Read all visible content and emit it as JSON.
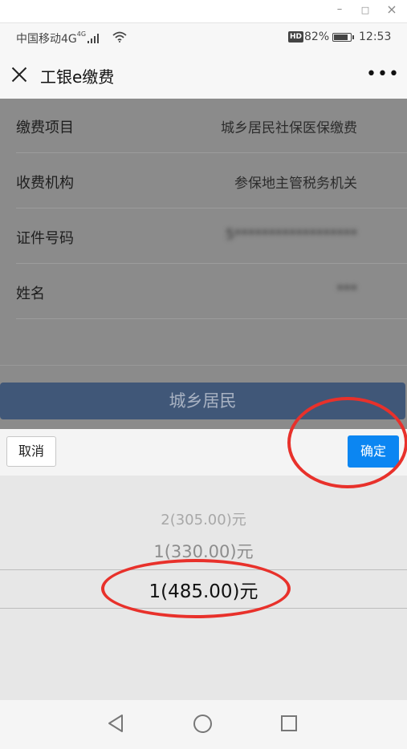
{
  "window": {
    "minimize_glyph": "–",
    "maximize_glyph": "□",
    "close_glyph": "×"
  },
  "status_bar": {
    "carrier": "中国移动4G",
    "network_sup": "4G",
    "hd_badge": "HD",
    "battery_percent": "82%",
    "battery_level": 0.82,
    "time": "12:53",
    "icons": [
      "signal-icon",
      "wifi-icon",
      "battery-icon"
    ]
  },
  "nav": {
    "title": "工银e缴费",
    "more_glyph": "•••"
  },
  "form": {
    "rows": [
      {
        "label": "缴费项目",
        "value": "城乡居民社保医保缴费"
      },
      {
        "label": "收费机构",
        "value": "参保地主管税务机关"
      },
      {
        "label": "证件号码",
        "value": "5******************"
      },
      {
        "label": "姓名",
        "value": "***"
      }
    ],
    "primary_button": "城乡居民"
  },
  "picker": {
    "cancel": "取消",
    "confirm": "确定",
    "options": [
      "2(305.00)元",
      "1(330.00)元",
      "1(485.00)元"
    ],
    "selected": "1(485.00)元"
  },
  "colors": {
    "primary_button_bg": "#405778",
    "confirm_bg": "#0b86f2",
    "annotation": "#e8312b",
    "overlay": "#8b8b8b"
  }
}
